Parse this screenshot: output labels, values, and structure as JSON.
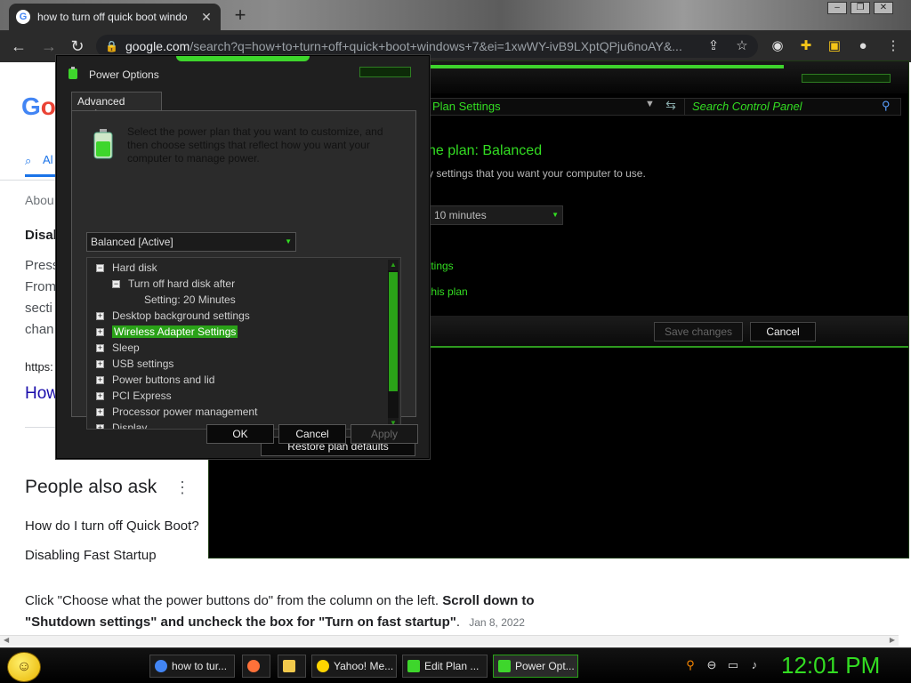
{
  "browser": {
    "tab_title": "how to turn off quick boot windo",
    "url_host": "google.com",
    "url_rest": "/search?q=how+to+turn+off+quick+boot+windows+7&ei=1xwWY-ivB9LXptQPju6noAY&..."
  },
  "google": {
    "logo": [
      "G",
      "o"
    ],
    "tab_all": "Al",
    "about": "Abou",
    "heading_partial": "Disal",
    "para_lines": [
      "Press",
      "From",
      "secti",
      "chan"
    ],
    "url_partial": "https:",
    "link_partial": "How",
    "people_also_ask": "People also ask",
    "paa_questions": [
      "How do I turn off Quick Boot?",
      "Disabling Fast Startup"
    ],
    "snippet_plain_1": "Click \"Choose what the power buttons do\" from the column on the left. ",
    "snippet_bold": "Scroll down to \"Shutdown settings\" and uncheck the box for \"Turn on fast startup\"",
    "snippet_plain_2": ".",
    "snippet_date": "Jan 8, 2022"
  },
  "control_panel": {
    "breadcrumb": "Plan Settings",
    "search_placeholder": "Search Control Panel",
    "heading": "he plan: Balanced",
    "subtitle": "y settings that you want your computer to use.",
    "sleep_value": "10 minutes",
    "link_advanced": "ttings",
    "link_restore": "this plan",
    "save_label": "Save changes",
    "cancel_label": "Cancel"
  },
  "power_options": {
    "title": "Power Options",
    "tab": "Advanced settings",
    "description": "Select the power plan that you want to customize, and then choose settings that reflect how you want your computer to manage power.",
    "plan_selected": "Balanced [Active]",
    "tree": [
      {
        "label": "Hard disk",
        "box": "−",
        "indent": 0
      },
      {
        "label": "Turn off hard disk after",
        "box": "−",
        "indent": 1
      },
      {
        "label": "Setting:  20 Minutes",
        "box": "",
        "indent": 2
      },
      {
        "label": "Desktop background settings",
        "box": "+",
        "indent": 0
      },
      {
        "label": "Wireless Adapter Settings",
        "box": "+",
        "indent": 0,
        "selected": true
      },
      {
        "label": "Sleep",
        "box": "+",
        "indent": 0
      },
      {
        "label": "USB settings",
        "box": "+",
        "indent": 0
      },
      {
        "label": "Power buttons and lid",
        "box": "+",
        "indent": 0
      },
      {
        "label": "PCI Express",
        "box": "+",
        "indent": 0
      },
      {
        "label": "Processor power management",
        "box": "+",
        "indent": 0
      },
      {
        "label": "Display",
        "box": "+",
        "indent": 0
      }
    ],
    "restore_label": "Restore plan defaults",
    "ok_label": "OK",
    "cancel_label": "Cancel",
    "apply_label": "Apply"
  },
  "taskbar": {
    "items": [
      {
        "label": "how to tur...",
        "icon": "chrome-icon",
        "color": "#4285f4"
      },
      {
        "label": "",
        "icon": "firefox-icon",
        "color": "#ff7139"
      },
      {
        "label": "",
        "icon": "folder-icon",
        "color": "#f2c94c"
      },
      {
        "label": "Yahoo! Me...",
        "icon": "yahoo-messenger-icon",
        "color": "#ffd400"
      },
      {
        "label": "Edit Plan ...",
        "icon": "control-panel-icon",
        "color": "#3ed62c"
      },
      {
        "label": "Power Opt...",
        "icon": "power-options-icon",
        "color": "#3ed62c"
      }
    ],
    "clock": "12:01 PM"
  },
  "colors": {
    "accent_green": "#33dd22",
    "selection_green": "#2aa218"
  }
}
